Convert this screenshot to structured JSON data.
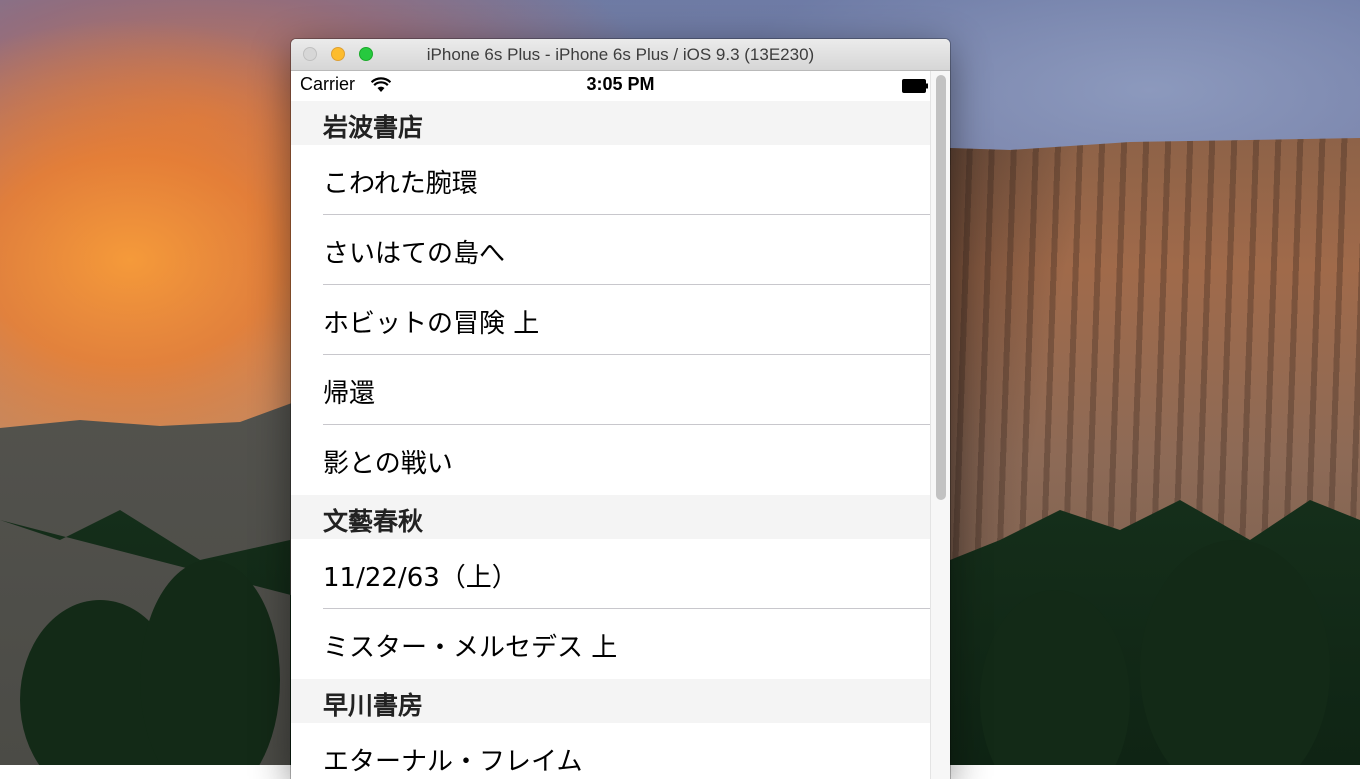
{
  "window": {
    "title": "iPhone 6s Plus - iPhone 6s Plus / iOS 9.3 (13E230)"
  },
  "status_bar": {
    "carrier": "Carrier",
    "time": "3:05 PM"
  },
  "sections": [
    {
      "header": "岩波書店",
      "items": [
        "こわれた腕環",
        "さいはての島へ",
        "ホビットの冒険 上",
        "帰還",
        "影との戦い"
      ]
    },
    {
      "header": "文藝春秋",
      "items": [
        "11/22/63（上）",
        "ミスター・メルセデス 上"
      ]
    },
    {
      "header": "早川書房",
      "items": [
        "エターナル・フレイム"
      ]
    }
  ],
  "colors": {
    "section_header_bg": "#f4f4f4",
    "separator": "#c8c7cc",
    "close_button": "#d7d7d7",
    "minimize_button": "#fdbc2e",
    "zoom_button": "#27c93f"
  },
  "icons": [
    "wifi-icon",
    "battery-icon"
  ]
}
